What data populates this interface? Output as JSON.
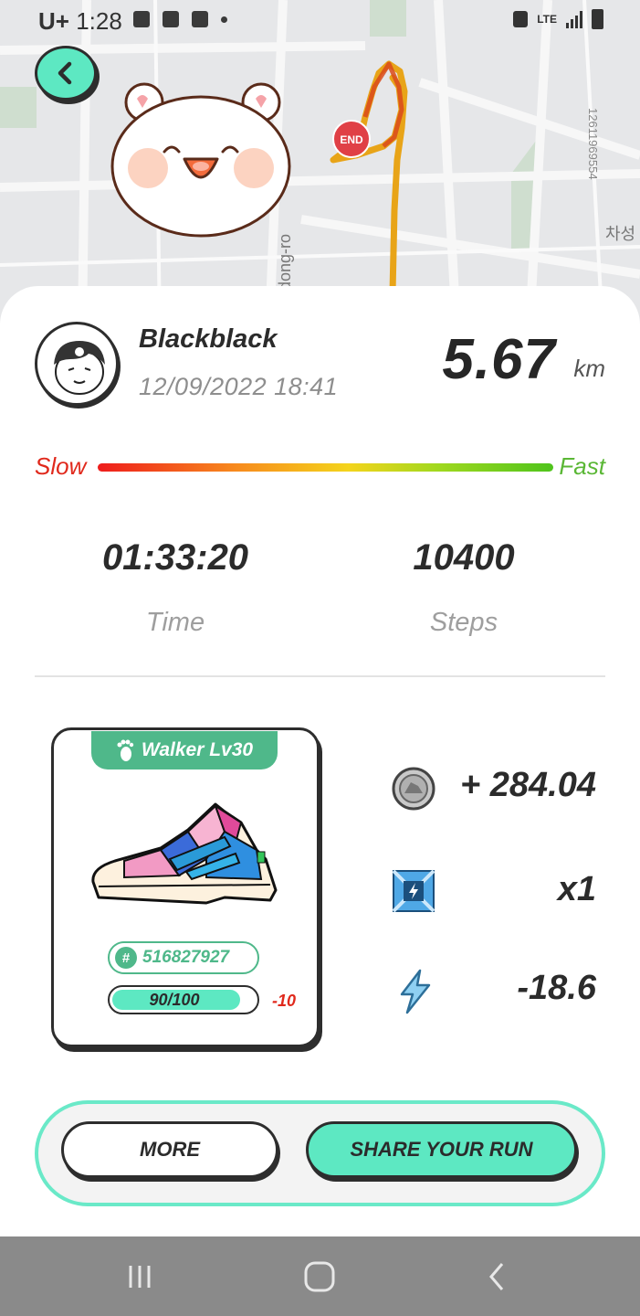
{
  "status_bar": {
    "carrier": "U+",
    "time": "1:28",
    "network": "LTE"
  },
  "map": {
    "road_label": "dong-ro",
    "side_label": "차성",
    "vertical_number": "12611969554",
    "end_marker": "END"
  },
  "profile": {
    "username": "Blackblack",
    "datetime": "12/09/2022 18:41",
    "distance": "5.67",
    "distance_unit": "km"
  },
  "speed_scale": {
    "slow_label": "Slow",
    "fast_label": "Fast"
  },
  "stats": {
    "time_value": "01:33:20",
    "time_label": "Time",
    "steps_value": "10400",
    "steps_label": "Steps"
  },
  "shoe": {
    "level_label": "Walker Lv30",
    "id": "516827927",
    "durability_text": "90/100",
    "durability_fraction": 0.9,
    "durability_loss": "-10"
  },
  "rewards": {
    "coin_icon": "running-coin-icon",
    "coin_value": "+ 284.04",
    "box_icon": "mystery-box-icon",
    "box_value": "x1",
    "energy_icon": "lightning-icon",
    "energy_value": "-18.6"
  },
  "actions": {
    "more_label": "MORE",
    "share_label": "SHARE YOUR RUN"
  },
  "colors": {
    "accent": "#5de8c2",
    "level_green": "#4fb88a",
    "slow_red": "#e0291c",
    "fast_green": "#5ab735"
  }
}
